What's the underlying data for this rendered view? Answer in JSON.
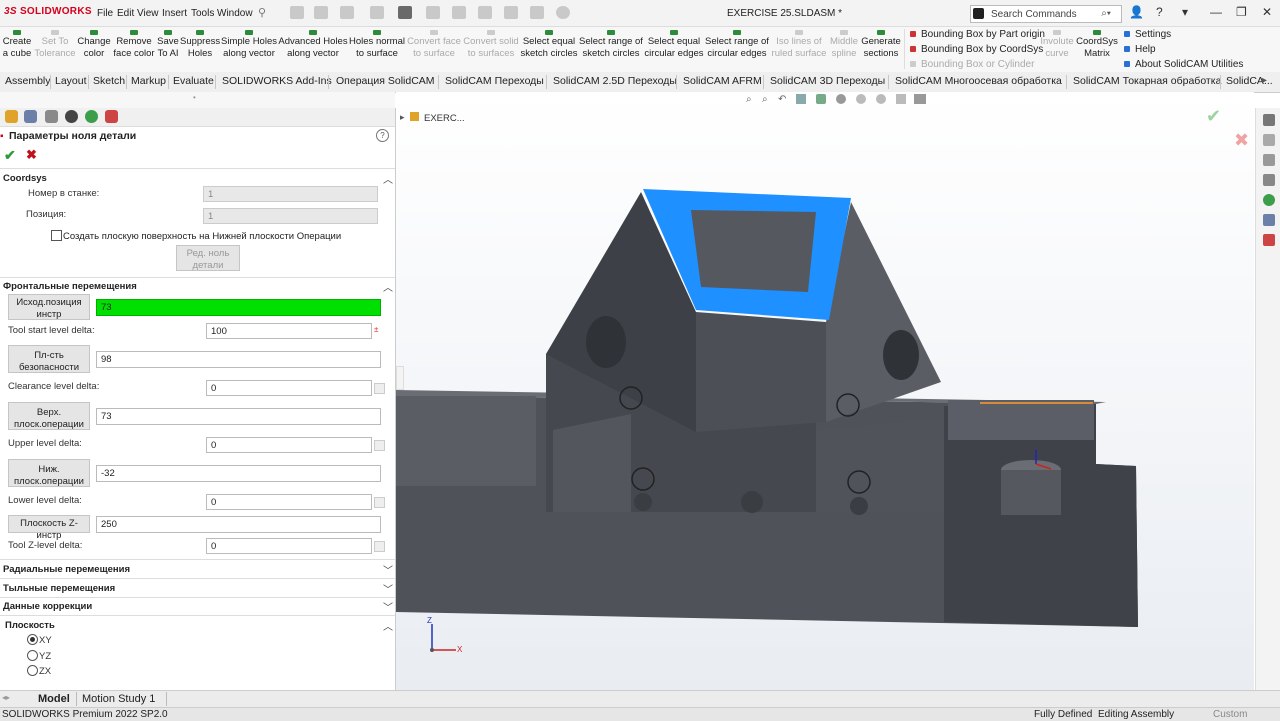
{
  "app": {
    "logo": "SOLIDWORKS",
    "logo_prefix": "3S",
    "doc_title": "EXERCISE 25.SLDASM *",
    "search_placeholder": "Search Commands",
    "menu": [
      "File",
      "Edit",
      "View",
      "Insert",
      "Tools",
      "Window"
    ]
  },
  "ribbon": {
    "buttons": [
      {
        "l1": "Create",
        "l2": "a cube",
        "disabled": false
      },
      {
        "l1": "Set To",
        "l2": "Tolerance",
        "disabled": true
      },
      {
        "l1": "Change",
        "l2": "color",
        "disabled": false
      },
      {
        "l1": "Remove",
        "l2": "face color",
        "disabled": false
      },
      {
        "l1": "Save",
        "l2": "To AI",
        "disabled": false
      },
      {
        "l1": "Suppress",
        "l2": "Holes",
        "disabled": false
      },
      {
        "l1": "Simple Holes",
        "l2": "along vector",
        "disabled": false
      },
      {
        "l1": "Advanced Holes",
        "l2": "along vector",
        "disabled": false
      },
      {
        "l1": "Holes normal",
        "l2": "to surface",
        "disabled": false
      },
      {
        "l1": "Convert face",
        "l2": "to surface",
        "disabled": true
      },
      {
        "l1": "Convert solid",
        "l2": "to surfaces",
        "disabled": true
      },
      {
        "l1": "Select equal",
        "l2": "sketch circles",
        "disabled": false
      },
      {
        "l1": "Select range of",
        "l2": "sketch circles",
        "disabled": false
      },
      {
        "l1": "Select equal",
        "l2": "circular edges",
        "disabled": false
      },
      {
        "l1": "Select range of",
        "l2": "circular edges",
        "disabled": false
      },
      {
        "l1": "Iso lines of",
        "l2": "ruled surface",
        "disabled": true
      },
      {
        "l1": "Middle",
        "l2": "spline",
        "disabled": true
      },
      {
        "l1": "Generate",
        "l2": "sections",
        "disabled": false
      }
    ],
    "bbox_items": [
      {
        "label": "Bounding Box by Part origin",
        "disabled": false
      },
      {
        "label": "Bounding Box by CoordSys",
        "disabled": false
      },
      {
        "label": "Bounding Box or Cylinder",
        "disabled": true
      }
    ],
    "extra_buttons": [
      {
        "l1": "Involute",
        "l2": "curve",
        "disabled": true
      },
      {
        "l1": "CoordSys",
        "l2": "Matrix",
        "disabled": false
      }
    ],
    "side_items": [
      "Settings",
      "Help",
      "About SolidCAM Utilities"
    ]
  },
  "tabs": [
    "Assembly",
    "Layout",
    "Sketch",
    "Markup",
    "Evaluate",
    "SOLIDWORKS Add-Ins",
    "Операция  SolidCAM",
    "SolidCAM Переходы",
    "SolidCAM 2.5D Переходы",
    "SolidCAM AFRM",
    "SolidCAM 3D Переходы",
    "SolidCAM Многоосевая обработка",
    "SolidCAM Токарная обработка",
    "SolidCA..."
  ],
  "panel": {
    "title": "Параметры ноля детали",
    "help": "?",
    "coordsys": {
      "header": "Coordsys",
      "machine_label": "Номер в станке:",
      "machine_value": "1",
      "position_label": "Позиция:",
      "position_value": "1",
      "checkbox_label": "Создать плоскую поверхность на Нижней плоскости Операции",
      "edit_button_l1": "Ред. ноль",
      "edit_button_l2": "детали"
    },
    "frontal": {
      "header": "Фронтальные перемещения",
      "rows": [
        {
          "btn_l1": "Исход.позиция",
          "btn_l2": "инстр",
          "value": "73",
          "delta_label": "Tool start level delta:",
          "delta_value": "100"
        },
        {
          "btn_l1": "Пл-сть",
          "btn_l2": "безопасности",
          "value": "98",
          "delta_label": "Clearance level delta:",
          "delta_value": "0"
        },
        {
          "btn_l1": "Верх.",
          "btn_l2": "плоск.операции",
          "value": "73",
          "delta_label": "Upper level delta:",
          "delta_value": "0"
        },
        {
          "btn_l1": "Ниж.",
          "btn_l2": "плоск.операции",
          "value": "-32",
          "delta_label": "Lower level delta:",
          "delta_value": "0"
        }
      ],
      "toolz_btn": "Плоскость Z- инстр",
      "toolz_value": "250",
      "toolz_delta_label": "Tool Z-level delta:",
      "toolz_delta_value": "0"
    },
    "collapsed": [
      "Радиальные перемещения",
      "Тыльные перемещения",
      "Данные коррекции"
    ],
    "plane": {
      "header": "Плоскость",
      "options": [
        "XY",
        "YZ",
        "ZX"
      ],
      "selected": "XY"
    }
  },
  "viewport": {
    "tree_label": "EXERC...",
    "axes": {
      "z": "Z",
      "x": "X"
    }
  },
  "bottom_tabs": [
    "Model",
    "Motion Study 1"
  ],
  "status": {
    "left": "SOLIDWORKS Premium 2022 SP2.0",
    "defined": "Fully Defined",
    "mode": "Editing Assembly",
    "units": "Custom"
  },
  "colors": {
    "accent_green": "#00e000",
    "selected_face": "#1e90ff",
    "model": "#4a4d55"
  }
}
